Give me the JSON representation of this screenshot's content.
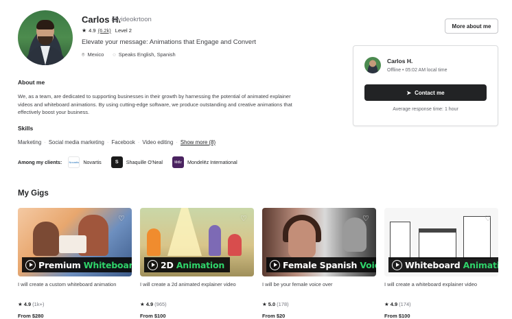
{
  "profile": {
    "name": "Carlos H.",
    "handle": "@videokrtoon",
    "rating": "4.9",
    "rating_count": "(6.2k)",
    "level": "Level 2",
    "tagline": "Elevate your message: Animations that Engage and Convert",
    "location": "Mexico",
    "languages": "Speaks English, Spanish",
    "more_about_label": "More about me"
  },
  "contact_card": {
    "name": "Carlos H.",
    "status": "Offline • 05:02 AM local time",
    "button_label": "Contact me",
    "response_time": "Average response time: 1 hour"
  },
  "about": {
    "title": "About me",
    "text": "We, as a team, are dedicated to supporting businesses in their growth by harnessing the potential of animated explainer videos and whiteboard animations. By using cutting-edge software, we produce outstanding and creative animations that effectively boost your business."
  },
  "skills": {
    "title": "Skills",
    "items": [
      "Marketing",
      "Social media marketing",
      "Facebook",
      "Video editing"
    ],
    "show_more": "Show more (8)"
  },
  "clients": {
    "label": "Among my clients:",
    "items": [
      {
        "name": "Novartis",
        "logo": "Novartis"
      },
      {
        "name": "Shaquille O'Neal",
        "logo": "S"
      },
      {
        "name": "Mondelēz International",
        "logo": "Mdlz"
      }
    ]
  },
  "gigs": {
    "title": "My Gigs",
    "items": [
      {
        "banner_main": "Premium ",
        "banner_accent": "Whiteboard",
        "description": "I will create a custom whiteboard animation",
        "rating": "4.9",
        "count": "(1k+)",
        "price": "From $280"
      },
      {
        "banner_main": "2D ",
        "banner_accent": "Animation",
        "description": "I will create a 2d animated explainer video",
        "rating": "4.9",
        "count": "(965)",
        "price": "From $100"
      },
      {
        "banner_main": "Female Spanish ",
        "banner_accent": "Voice",
        "description": "I will be your female voice over",
        "rating": "5.0",
        "count": "(178)",
        "price": "From $20"
      },
      {
        "banner_main": "Whiteboard ",
        "banner_accent": "Animation",
        "description": "I will create a whiteboard explainer video",
        "rating": "4.9",
        "count": "(174)",
        "price": "From $100"
      }
    ]
  },
  "colors": {
    "accent_green": "#2fd36a",
    "button_dark": "#222325",
    "muted_text": "#74767e"
  }
}
